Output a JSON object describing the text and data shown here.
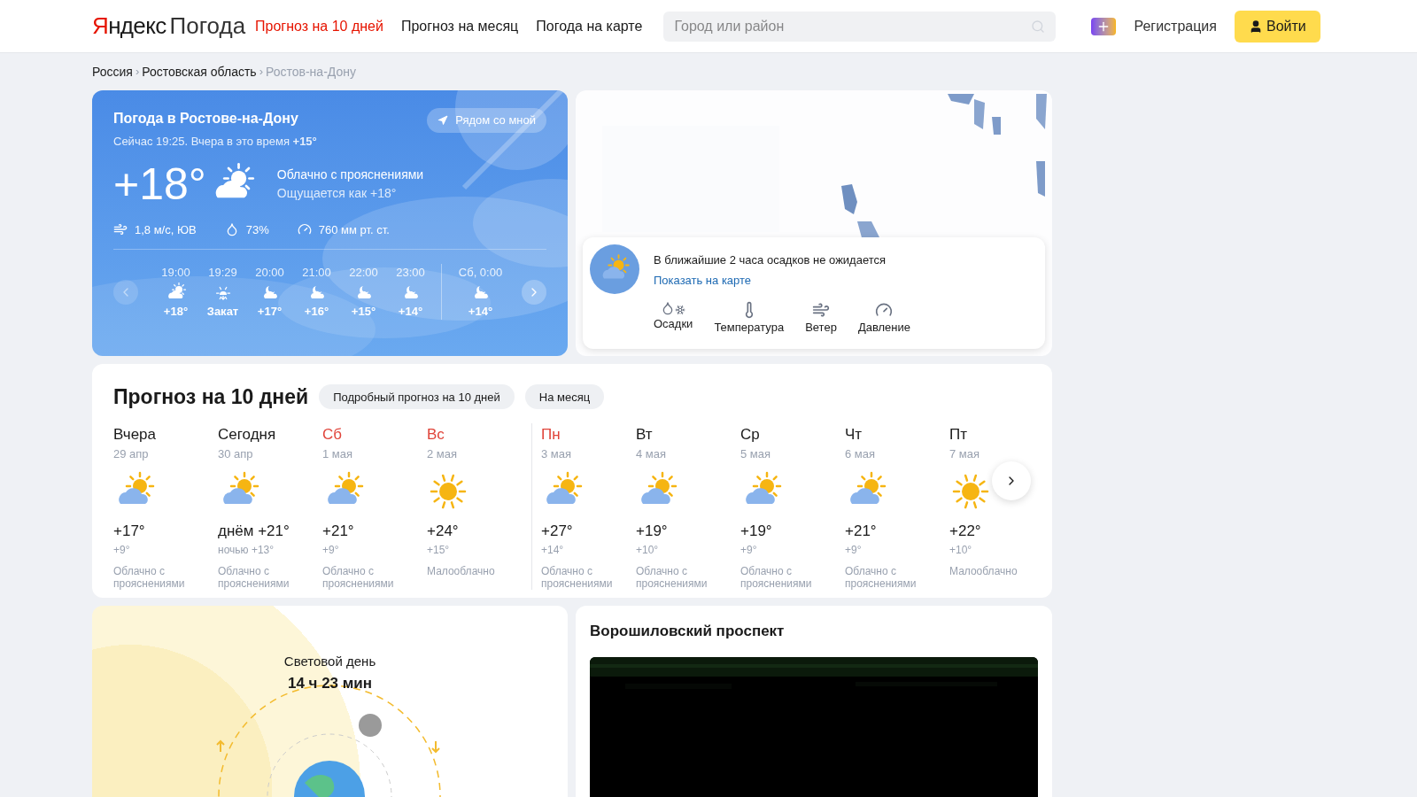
{
  "header": {
    "logo": {
      "brand": "Яндекс",
      "product": "Погода"
    },
    "nav": [
      {
        "label": "Прогноз на 10 дней",
        "selected": true
      },
      {
        "label": "Прогноз на месяц",
        "selected": false
      },
      {
        "label": "Погода на карте",
        "selected": false
      }
    ],
    "search": {
      "placeholder": "Город или район"
    },
    "register": "Регистрация",
    "login": "Войти"
  },
  "breadcrumbs": {
    "separator": "›",
    "items": [
      {
        "label": "Россия",
        "current": false
      },
      {
        "label": "Ростовская область",
        "current": false
      },
      {
        "label": "Ростов-на-Дону",
        "current": true
      }
    ]
  },
  "now": {
    "title": "Погода в Ростове-на-Дону",
    "subtitle": "Сейчас 19:25. Вчера в это время **+15°**",
    "nearby_button": "Рядом со мной",
    "temperature": "+18°",
    "kind": "partly_cloudy",
    "condition": "Облачно с прояснениями",
    "feels_like": "Ощущается как +18°",
    "wind": "1,8 м/с, ЮВ",
    "humidity": "73%",
    "pressure": "760 мм рт. ст.",
    "hourly": [
      {
        "time": "19:00",
        "kind": "partly_cloudy",
        "value": "+18°",
        "day_break": false
      },
      {
        "time": "19:29",
        "kind": "sunset",
        "value": "Закат",
        "day_break": false
      },
      {
        "time": "20:00",
        "kind": "night_cloudy",
        "value": "+17°",
        "day_break": false
      },
      {
        "time": "21:00",
        "kind": "night_cloudy",
        "value": "+16°",
        "day_break": false
      },
      {
        "time": "22:00",
        "kind": "night_cloudy",
        "value": "+15°",
        "day_break": false
      },
      {
        "time": "23:00",
        "kind": "night_cloudy",
        "value": "+14°",
        "day_break": false
      },
      {
        "time": "Сб, 0:00",
        "kind": "night_cloudy",
        "value": "+14°",
        "day_break": true
      }
    ]
  },
  "map": {
    "message": "В ближайшие 2 часа осадков не ожидается",
    "link": "Показать на карте",
    "layers": [
      {
        "label": "Осадки",
        "kind": "precipitation"
      },
      {
        "label": "Температура",
        "kind": "thermometer"
      },
      {
        "label": "Ветер",
        "kind": "wind"
      },
      {
        "label": "Давление",
        "kind": "gauge"
      }
    ]
  },
  "forecast": {
    "title": "Прогноз на 10 дней",
    "buttons": [
      "Подробный прогноз на 10 дней",
      "На месяц"
    ],
    "days": [
      {
        "day": "Вчера",
        "date": "29 апр",
        "weekend": false,
        "week_break": false,
        "kind": "partly_cloudy",
        "day_temp": "+17°",
        "night_temp": "+9°",
        "condition": "Облачно с прояснениями"
      },
      {
        "day": "Сегодня",
        "date": "30 апр",
        "weekend": false,
        "week_break": false,
        "kind": "partly_cloudy",
        "day_temp": "днём +21°",
        "night_temp": "ночью +13°",
        "condition": "Облачно с прояснениями"
      },
      {
        "day": "Сб",
        "date": "1 мая",
        "weekend": true,
        "week_break": false,
        "kind": "partly_cloudy",
        "day_temp": "+21°",
        "night_temp": "+9°",
        "condition": "Облачно с прояснениями"
      },
      {
        "day": "Вс",
        "date": "2 мая",
        "weekend": true,
        "week_break": false,
        "kind": "sunny",
        "day_temp": "+24°",
        "night_temp": "+15°",
        "condition": "Малооблачно"
      },
      {
        "day": "Пн",
        "date": "3 мая",
        "weekend": true,
        "week_break": true,
        "kind": "partly_cloudy",
        "day_temp": "+27°",
        "night_temp": "+14°",
        "condition": "Облачно с прояснениями"
      },
      {
        "day": "Вт",
        "date": "4 мая",
        "weekend": false,
        "week_break": false,
        "kind": "partly_cloudy",
        "day_temp": "+19°",
        "night_temp": "+10°",
        "condition": "Облачно с прояснениями"
      },
      {
        "day": "Ср",
        "date": "5 мая",
        "weekend": false,
        "week_break": false,
        "kind": "partly_cloudy",
        "day_temp": "+19°",
        "night_temp": "+9°",
        "condition": "Облачно с прояснениями"
      },
      {
        "day": "Чт",
        "date": "6 мая",
        "weekend": false,
        "week_break": false,
        "kind": "partly_cloudy",
        "day_temp": "+21°",
        "night_temp": "+9°",
        "condition": "Облачно с прояснениями"
      },
      {
        "day": "Пт",
        "date": "7 мая",
        "weekend": false,
        "week_break": false,
        "kind": "sunny",
        "day_temp": "+22°",
        "night_temp": "+10°",
        "condition": "Малооблачно"
      }
    ]
  },
  "daylight": {
    "title": "Световой день",
    "value": "14 ч 23 мин"
  },
  "camera": {
    "title": "Ворошиловский проспект"
  }
}
